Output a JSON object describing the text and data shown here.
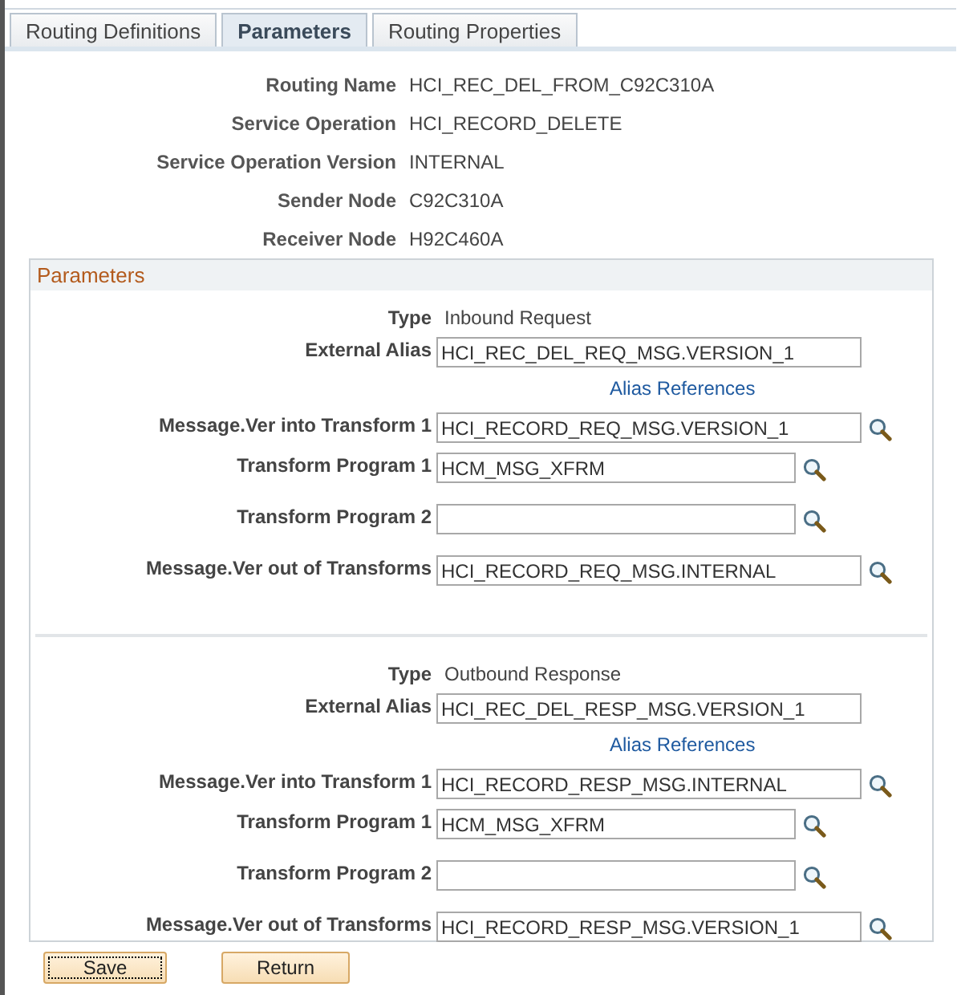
{
  "tabs": [
    {
      "label": "Routing Definitions",
      "selected": false
    },
    {
      "label": "Parameters",
      "selected": true
    },
    {
      "label": "Routing Properties",
      "selected": false
    }
  ],
  "details": [
    {
      "label": "Routing Name",
      "value": "HCI_REC_DEL_FROM_C92C310A"
    },
    {
      "label": "Service Operation",
      "value": "HCI_RECORD_DELETE"
    },
    {
      "label": "Service Operation Version",
      "value": "INTERNAL"
    },
    {
      "label": "Sender Node",
      "value": "C92C310A"
    },
    {
      "label": "Receiver Node",
      "value": "H92C460A"
    }
  ],
  "parameters": {
    "title": "Parameters",
    "sections": [
      {
        "fields": [
          {
            "kind": "text",
            "label": "Type",
            "value": "Inbound Request"
          },
          {
            "kind": "alias",
            "label": "External Alias",
            "value": "HCI_REC_DEL_REQ_MSG.VERSION_1",
            "link": "Alias References"
          },
          {
            "kind": "wide",
            "label": "Message.Ver into Transform 1",
            "value": "HCI_RECORD_REQ_MSG.VERSION_1"
          },
          {
            "kind": "narrow",
            "label": "Transform Program 1",
            "value": "HCM_MSG_XFRM"
          },
          {
            "kind": "narrow",
            "label": "Transform Program 2"
          },
          {
            "kind": "wide",
            "label": "Message.Ver out of Transforms",
            "value": "HCI_RECORD_REQ_MSG.INTERNAL"
          }
        ]
      },
      {
        "fields": [
          {
            "kind": "text",
            "label": "Type",
            "value": "Outbound Response"
          },
          {
            "kind": "alias",
            "label": "External Alias",
            "value": "HCI_REC_DEL_RESP_MSG.VERSION_1",
            "link": "Alias References"
          },
          {
            "kind": "wide",
            "label": "Message.Ver into Transform 1",
            "value": "HCI_RECORD_RESP_MSG.INTERNAL"
          },
          {
            "kind": "narrow",
            "label": "Transform Program 1",
            "value": "HCM_MSG_XFRM"
          },
          {
            "kind": "narrow",
            "label": "Transform Program 2"
          },
          {
            "kind": "wide",
            "label": "Message.Ver out of Transforms",
            "value": "HCI_RECORD_RESP_MSG.VERSION_1"
          }
        ]
      }
    ]
  },
  "buttons": [
    {
      "label": "Save",
      "focused": true
    },
    {
      "label": "Return",
      "focused": false
    }
  ]
}
